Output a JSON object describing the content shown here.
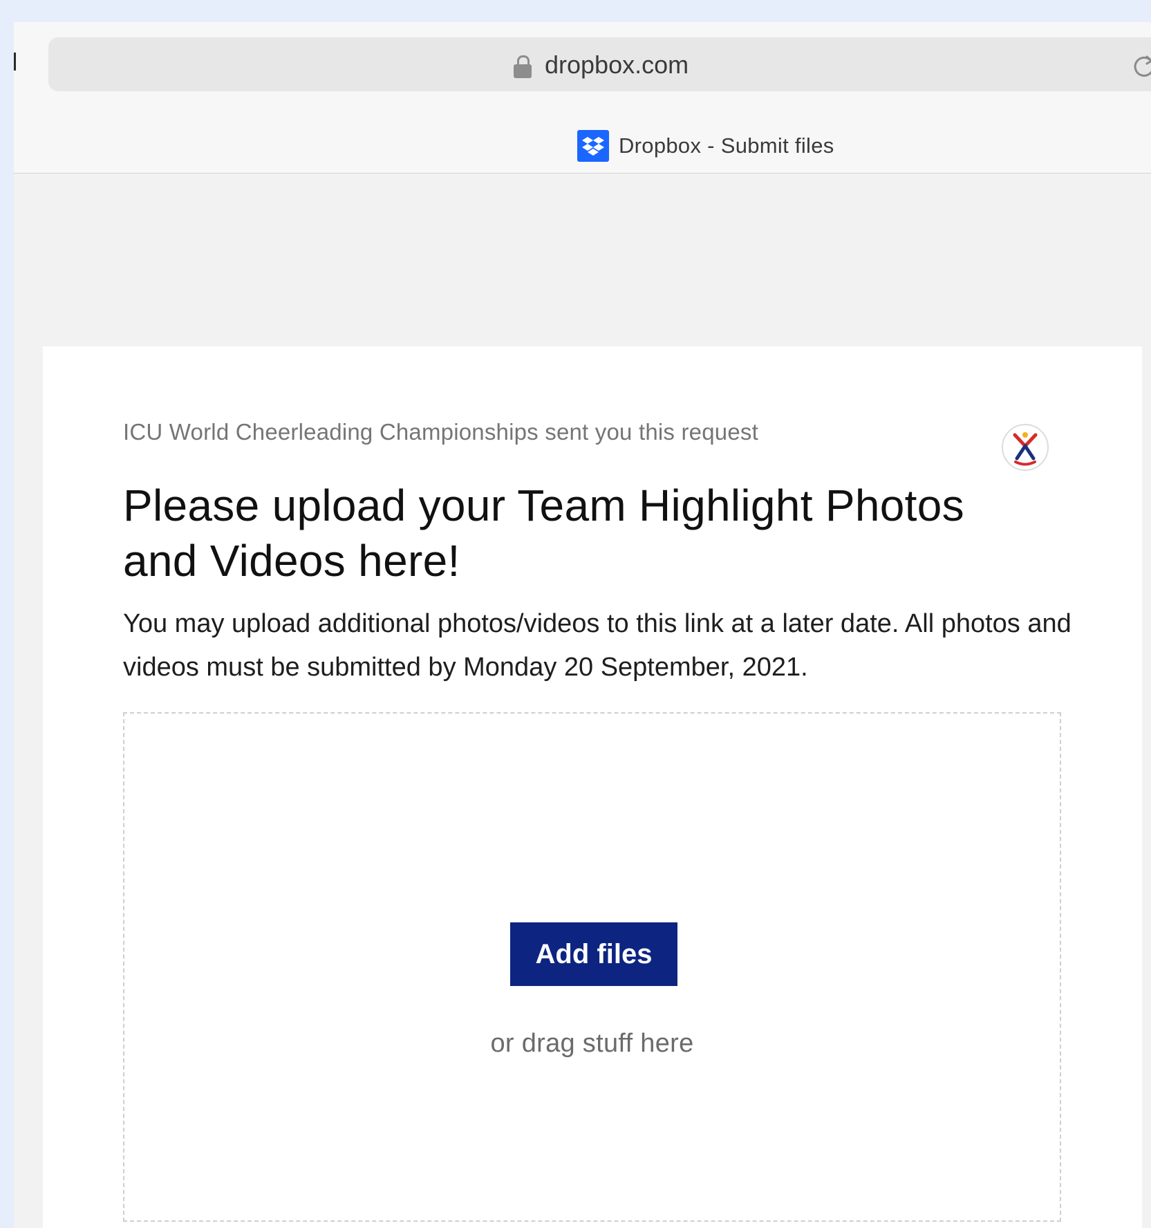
{
  "browser": {
    "url": "dropbox.com",
    "tab_title": "Dropbox - Submit files",
    "icons": {
      "lock": "lock-icon",
      "reload": "reload-icon",
      "favicon": "dropbox-logo-icon"
    }
  },
  "request": {
    "sender_line": "ICU World Cheerleading Championships sent you this request",
    "title": "Please upload your Team Highlight Photos and Videos here!",
    "description": "You may upload additional photos/videos to this link at a later date. All photos and videos must be submitted by Monday 20 September, 2021.",
    "avatar_icon": "icu-logo-icon"
  },
  "upload": {
    "button_label": "Add files",
    "drag_hint": "or drag stuff here"
  },
  "colors": {
    "button_bg": "#0d2481",
    "favicon_bg": "#1b66ff",
    "page_bg": "#f2f2f2",
    "outer_bg": "#e6edfb"
  }
}
